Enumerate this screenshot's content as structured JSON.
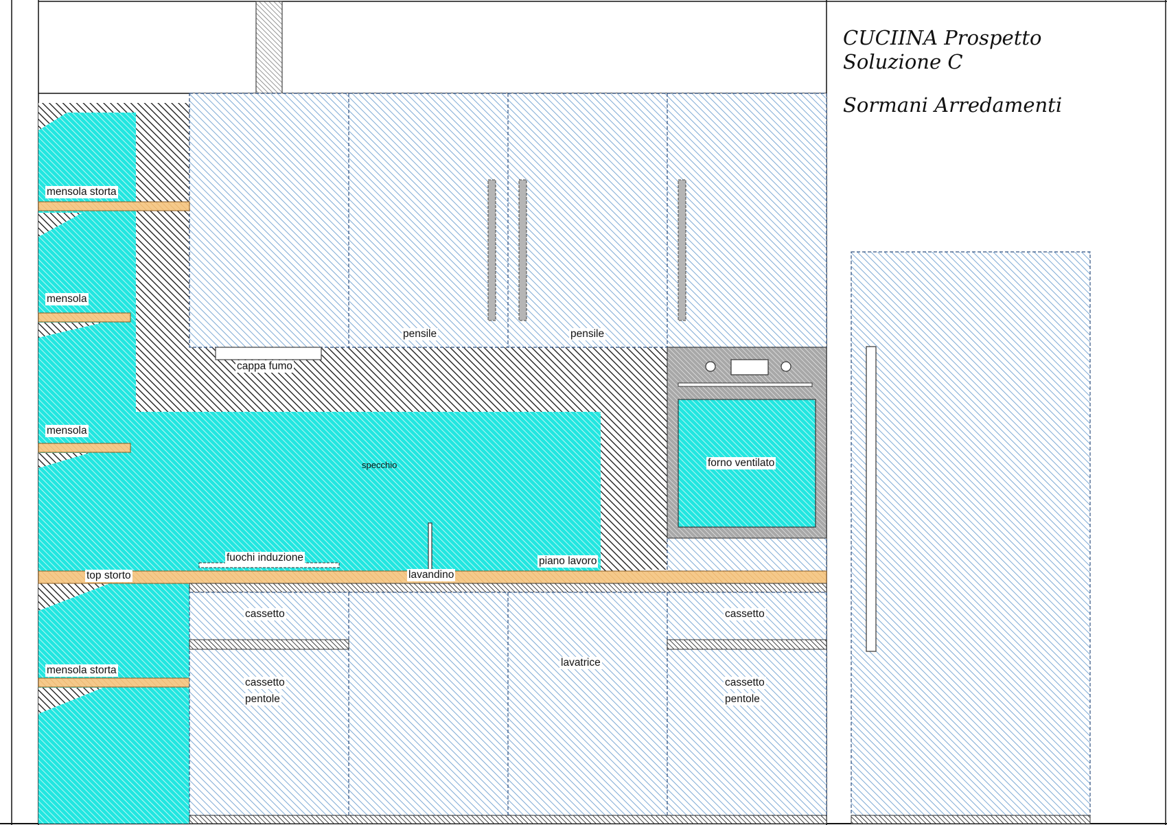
{
  "title": {
    "line1": "CUCIINA Prospetto",
    "line2": "Soluzione C",
    "company": "Sormani Arredamenti"
  },
  "labels": {
    "mensola_storta_top": "mensola storta",
    "mensola_1": "mensola",
    "mensola_2": "mensola",
    "mensola_storta_bottom": "mensola storta",
    "pensile_1": "pensile",
    "pensile_2": "pensile",
    "cappa_fumo": "cappa fumo",
    "specchio": "specchio",
    "forno_ventilato": "forno ventilato",
    "fuochi_induzione": "fuochi induzione",
    "piano_lavoro": "piano lavoro",
    "top_storto": "top storto",
    "lavandino": "lavandino",
    "cassetto_left": "cassetto",
    "cassetto_right": "cassetto",
    "cassetto_pentole_left_1": "cassetto",
    "cassetto_pentole_left_2": "pentole",
    "cassetto_pentole_right_1": "cassetto",
    "cassetto_pentole_right_2": "pentole",
    "lavatrice": "lavatrice"
  },
  "colors": {
    "cabinet_hatch": "#6fa0d0",
    "cyan_fill": "#22e6e0",
    "wood": "#f5c98a",
    "black_hatch": "#111111",
    "oven_gray": "#a8a8a8"
  }
}
